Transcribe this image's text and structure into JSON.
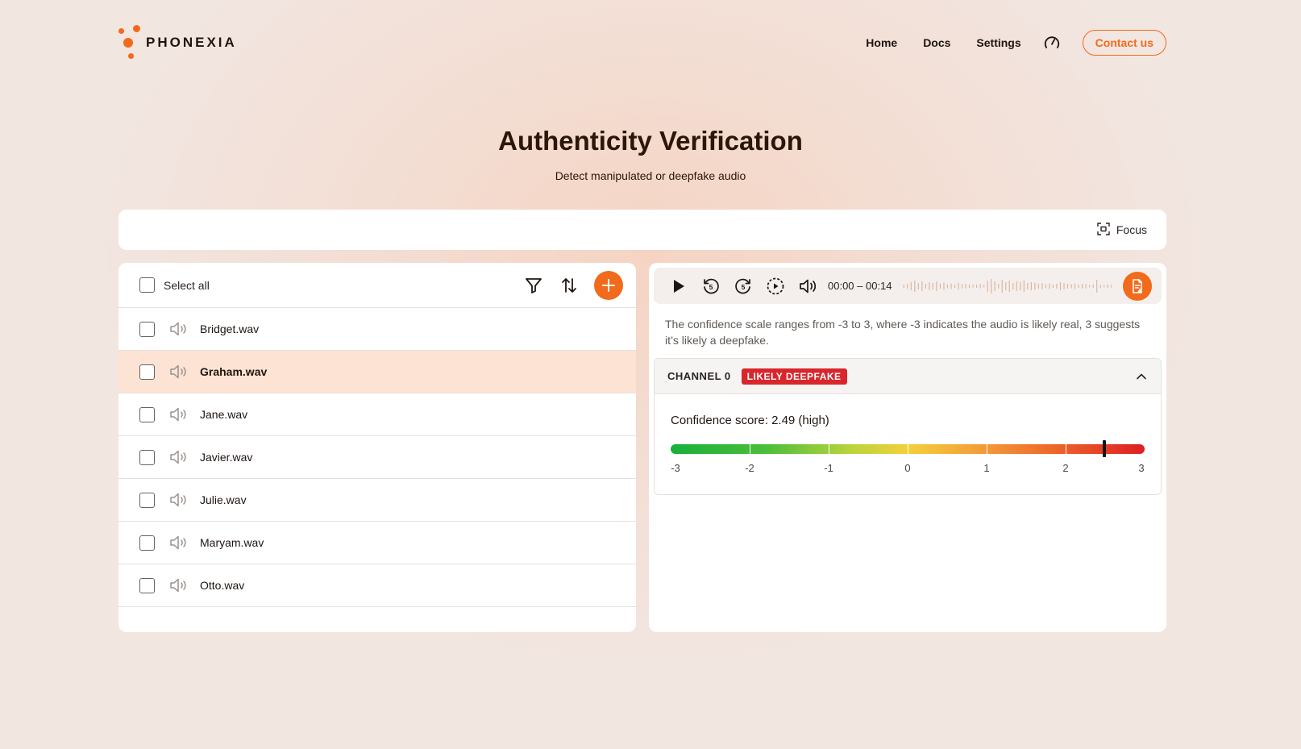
{
  "brand": {
    "name": "PHONEXIA",
    "accent": "#f26a1b"
  },
  "nav": {
    "links": [
      "Home",
      "Docs",
      "Settings"
    ],
    "speed_icon": "speedometer-icon",
    "contact_label": "Contact us"
  },
  "hero": {
    "title": "Authenticity Verification",
    "subtitle": "Detect manipulated or deepfake audio"
  },
  "toolbar": {
    "focus_label": "Focus",
    "focus_icon": "focus-frame-icon"
  },
  "file_list": {
    "select_all_label": "Select all",
    "actions": [
      "filter-icon",
      "sort-icon",
      "add-icon"
    ],
    "files": [
      {
        "name": "Bridget.wav",
        "selected": false
      },
      {
        "name": "Graham.wav",
        "selected": true
      },
      {
        "name": "Jane.wav",
        "selected": false
      },
      {
        "name": "Javier.wav",
        "selected": false
      },
      {
        "name": "Julie.wav",
        "selected": false
      },
      {
        "name": "Maryam.wav",
        "selected": false
      },
      {
        "name": "Otto.wav",
        "selected": false
      }
    ]
  },
  "player": {
    "time": "00:00 – 00:14",
    "controls": [
      "play-icon",
      "rewind-5-icon",
      "forward-5-icon",
      "playback-speed-icon",
      "volume-icon"
    ],
    "export_icon": "export-report-icon"
  },
  "result": {
    "note": "The confidence scale ranges from -3 to 3, where -3 indicates the audio is likely real, 3 suggests it’s likely a deepfake.",
    "channel_label": "CHANNEL 0",
    "badge": "LIKELY DEEPFAKE",
    "badge_color": "#d9262c",
    "score_label": "Confidence score: 2.49 (high)",
    "score": 2.49,
    "scale_min": -3,
    "scale_max": 3,
    "scale_ticks": [
      "-3",
      "-2",
      "-1",
      "0",
      "1",
      "2",
      "3"
    ]
  }
}
